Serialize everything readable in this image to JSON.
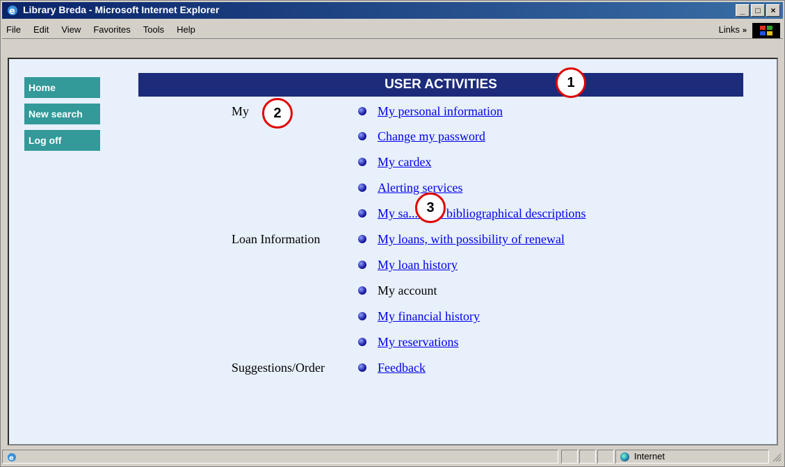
{
  "window": {
    "title": "Library Breda - Microsoft Internet Explorer"
  },
  "menu": {
    "items": [
      "File",
      "Edit",
      "View",
      "Favorites",
      "Tools",
      "Help"
    ],
    "links_label": "Links"
  },
  "sidenav": {
    "items": [
      "Home",
      "New search",
      "Log off"
    ]
  },
  "header": {
    "title": "USER ACTIVITIES"
  },
  "sections": [
    {
      "category": "My",
      "entries": [
        {
          "text": "My personal information",
          "link": true
        },
        {
          "text": "Change my password",
          "link": true
        },
        {
          "text": "My cardex",
          "link": true
        },
        {
          "text": "Alerting services",
          "link": true
        },
        {
          "text": "My sa... with bibliographical descriptions",
          "link": true
        }
      ]
    },
    {
      "category": "Loan Information",
      "entries": [
        {
          "text": "My loans, with possibility of renewal",
          "link": true
        },
        {
          "text": "My loan history",
          "link": true
        },
        {
          "text": "My account",
          "link": false
        },
        {
          "text": "My financial history",
          "link": true
        },
        {
          "text": "My reservations",
          "link": true
        }
      ]
    },
    {
      "category": "Suggestions/Order",
      "entries": [
        {
          "text": "Feedback",
          "link": true
        }
      ]
    }
  ],
  "callouts": [
    "1",
    "2",
    "3"
  ],
  "statusbar": {
    "zone": "Internet"
  },
  "colors": {
    "header": "#1c2b7a",
    "nav": "#339999",
    "link": "#0000ee",
    "callout": "#e00000"
  }
}
